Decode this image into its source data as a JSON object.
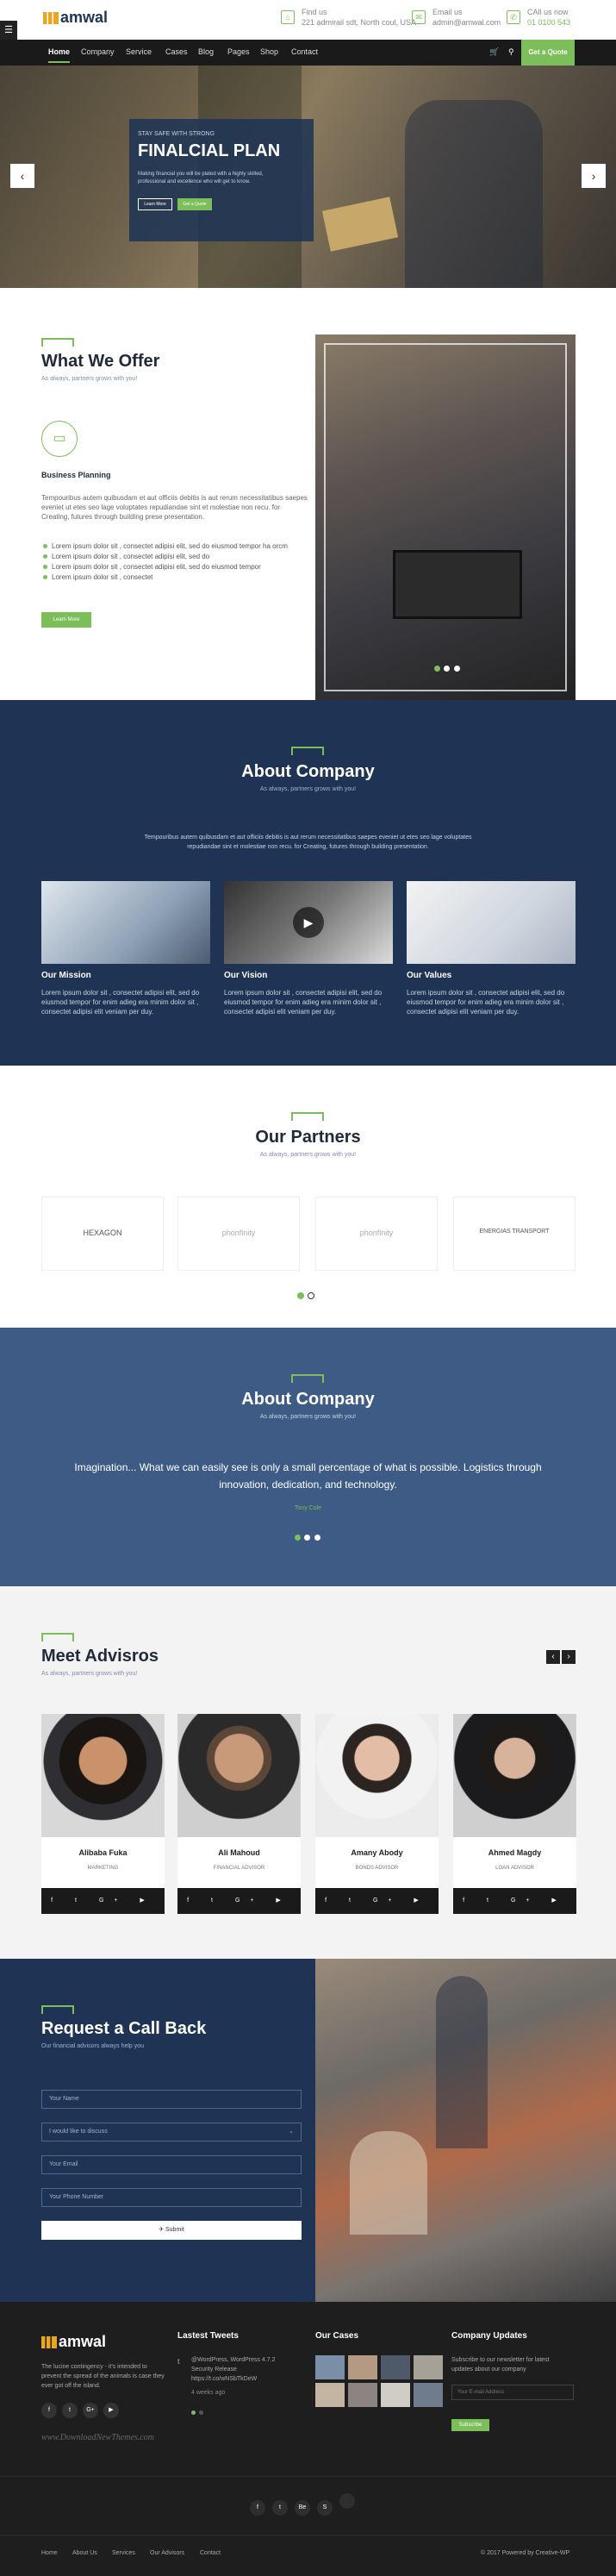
{
  "header": {
    "logo_text": "amwal",
    "contacts": [
      {
        "label": "Find us",
        "value": "221 admirail sdt, North coul, USA"
      },
      {
        "label": "Email us",
        "value": "admin@amwal.com"
      },
      {
        "label": "CAll us now",
        "value": "01 0100 543"
      }
    ]
  },
  "nav": {
    "items": [
      "Home",
      "Company",
      "Service",
      "Cases",
      "Blog",
      "Pages",
      "Shop",
      "Contact"
    ],
    "quote_label": "Get a Quote"
  },
  "hero": {
    "kicker": "STAY SAFE WITH STRONG",
    "title": "FINALCIAL PLAN",
    "text": "Making financial you will be plated with a highly skilled, professional and excellence who will get to know.",
    "btn_primary": "Learn More",
    "btn_secondary": "Get a Quote"
  },
  "offer": {
    "title": "What We Offer",
    "subtitle": "As always, partners grows with you!",
    "item_title": "Business Planning",
    "text": "Tempouribus autem quibusdam et aut officiis debitis is aut rerum necessitatibus saepes eveniet ut etes seo lage voluptates repudiandae sint et molestiae non recu. for Creating, futures through building prese presentation.",
    "bullets": [
      "Lorem ipsum dolor sit , consectet adipisi elit, sed do eiusmod tempor ha orcm",
      "Lorem ipsum dolor sit , consectet adipisi elit, sed do",
      "Lorem ipsum dolor sit , consectet adipisi elit, sed do eiusmod tempor",
      "Lorem ipsum dolor sit , consectet"
    ],
    "button": "Learn More"
  },
  "about": {
    "title": "About Company",
    "subtitle": "As always, partners grows with you!",
    "text": "Tempouribus autem quibusdam et aut officiis debitis is aut rerum necessitatibus saepes eveniet ut etes seo lage voluptates repudiandae sint et molestiae non recu. for Creating, futures through building presentation.",
    "cards": [
      {
        "title": "Our Mission",
        "text": "Lorem ipsum dolor sit , consectet adipisi elit, sed do eiusmod tempor for enim adieg era minim dolor sit , consectet adipisi elit veniam per duy."
      },
      {
        "title": "Our Vision",
        "text": "Lorem ipsum dolor sit , consectet adipisi elit, sed do eiusmod tempor for enim adieg era minim dolor sit , consectet adipisi elit veniam per duy."
      },
      {
        "title": "Our Values",
        "text": "Lorem ipsum dolor sit , consectet adipisi elit, sed do eiusmod tempor for enim adieg era minim dolor sit , consectet adipisi elit veniam per duy."
      }
    ]
  },
  "partners": {
    "title": "Our Partners",
    "subtitle": "As always, partners grows with you!",
    "logos": [
      "HEXAGON",
      "phonfinity",
      "phonfinity",
      "ENERGIAS TRANSPORT"
    ]
  },
  "testimonial": {
    "title": "About Company",
    "subtitle": "As always, partners grows with you!",
    "quote": "Imagination... What we can easily see is only a small percentage of what is possible. Logistics through innovation, dedication, and technology.",
    "author": "Tony Cole"
  },
  "advisors": {
    "title": "Meet Advisros",
    "subtitle": "As always, partners grows with you!",
    "people": [
      {
        "name": "Alibaba Fuka",
        "role": "MARKETING"
      },
      {
        "name": "Ali Mahoud",
        "role": "FINANCIAL ADVISOR"
      },
      {
        "name": "Amany Abody",
        "role": "BONDS ADVISOR"
      },
      {
        "name": "Ahmed Magdy",
        "role": "LOAN ADVISOR"
      }
    ]
  },
  "callback": {
    "title": "Request a Call Back",
    "subtitle": "Our financial advisors always help you",
    "name_ph": "Your Name",
    "select_ph": "I would like to discuss",
    "email_ph": "Your Email",
    "phone_ph": "Your Phone Number",
    "submit": "Submit"
  },
  "footer": {
    "about": "The lucine contingency - it's intended to prevent the spread of the animals is case they ever got off the island.",
    "tweets_title": "Lastest Tweets",
    "tweet": "@WordPress, WordPress 4.7.2 Security Release https://t.co/wNSbTkDeW",
    "tweet_time": "4 weeks ago",
    "cases_title": "Our Cases",
    "updates_title": "Company Updates",
    "updates_text": "Subscribe to our newsletter for latest updates about our company",
    "email_ph": "Your E-mail Address",
    "subscribe": "Subscribe",
    "watermark": "www.DownloadNewThemes.com",
    "bottom_links": [
      "Home",
      "About Us",
      "Services",
      "Our Advisors",
      "Contact"
    ],
    "copyright": "© 2017 Powered by Creative-WP"
  },
  "colors": {
    "accent": "#7cbf5a",
    "navy": "#1f3454",
    "dark": "#1a1a1a"
  }
}
